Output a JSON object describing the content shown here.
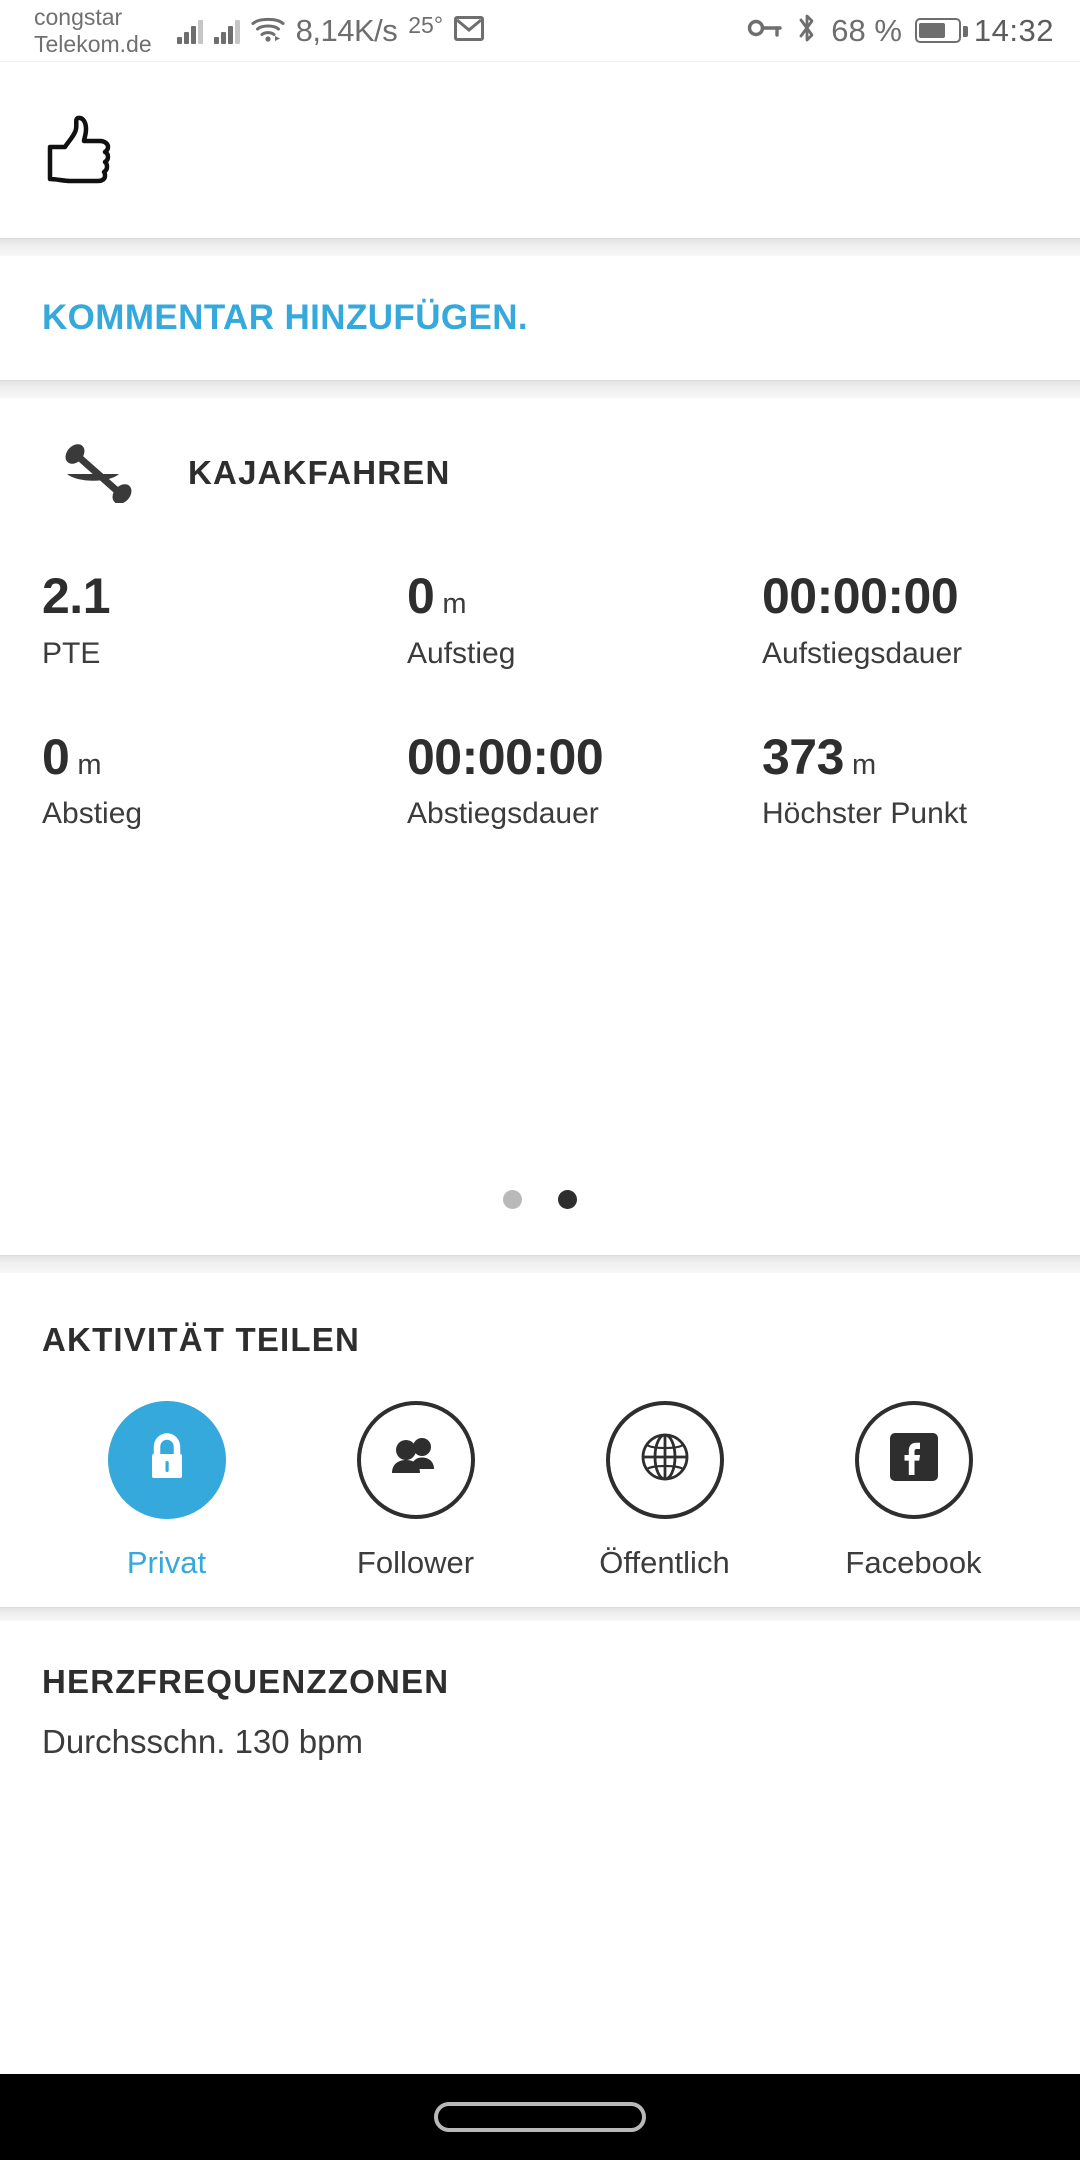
{
  "statusbar": {
    "carrier_line1": "congstar",
    "carrier_line2": "Telekom.de",
    "net_speed": "8,14K/s",
    "temperature": "25°",
    "mail_icon": "gmail-icon",
    "vpn_key_icon": "vpn-key-icon",
    "bluetooth_icon": "bluetooth-icon",
    "battery_percent": "68 %",
    "clock": "14:32"
  },
  "reaction": {
    "icon": "thumbs-up-icon"
  },
  "comment": {
    "link_label": "KOMMENTAR HINZUFÜGEN."
  },
  "activity": {
    "icon": "kayak-icon",
    "title": "KAJAKFAHREN",
    "stats": [
      {
        "value": "2.1",
        "unit": "",
        "label": "PTE"
      },
      {
        "value": "0",
        "unit": "m",
        "label": "Aufstieg"
      },
      {
        "value": "00:00:00",
        "unit": "",
        "label": "Aufstiegsdauer"
      },
      {
        "value": "0",
        "unit": "m",
        "label": "Abstieg"
      },
      {
        "value": "00:00:00",
        "unit": "",
        "label": "Abstiegsdauer"
      },
      {
        "value": "373",
        "unit": "m",
        "label": "Höchster Punkt"
      }
    ],
    "pager": {
      "count": 2,
      "active_index": 1
    }
  },
  "share": {
    "title": "AKTIVITÄT TEILEN",
    "selected": "Privat",
    "options": [
      {
        "label": "Privat",
        "icon": "lock-icon",
        "selected": true
      },
      {
        "label": "Follower",
        "icon": "people-icon",
        "selected": false
      },
      {
        "label": "Öffentlich",
        "icon": "globe-icon",
        "selected": false
      },
      {
        "label": "Facebook",
        "icon": "facebook-icon",
        "selected": false
      }
    ]
  },
  "heart_rate": {
    "title": "HERZFREQUENZZONEN",
    "average": "Durchsschn. 130 bpm"
  },
  "navbar": {
    "pill": "home-gesture-pill"
  },
  "colors": {
    "accent": "#35a8dc",
    "text_dark": "#2e2e2e",
    "text_muted": "#6e6e6e",
    "divider": "#e3e3e3"
  }
}
